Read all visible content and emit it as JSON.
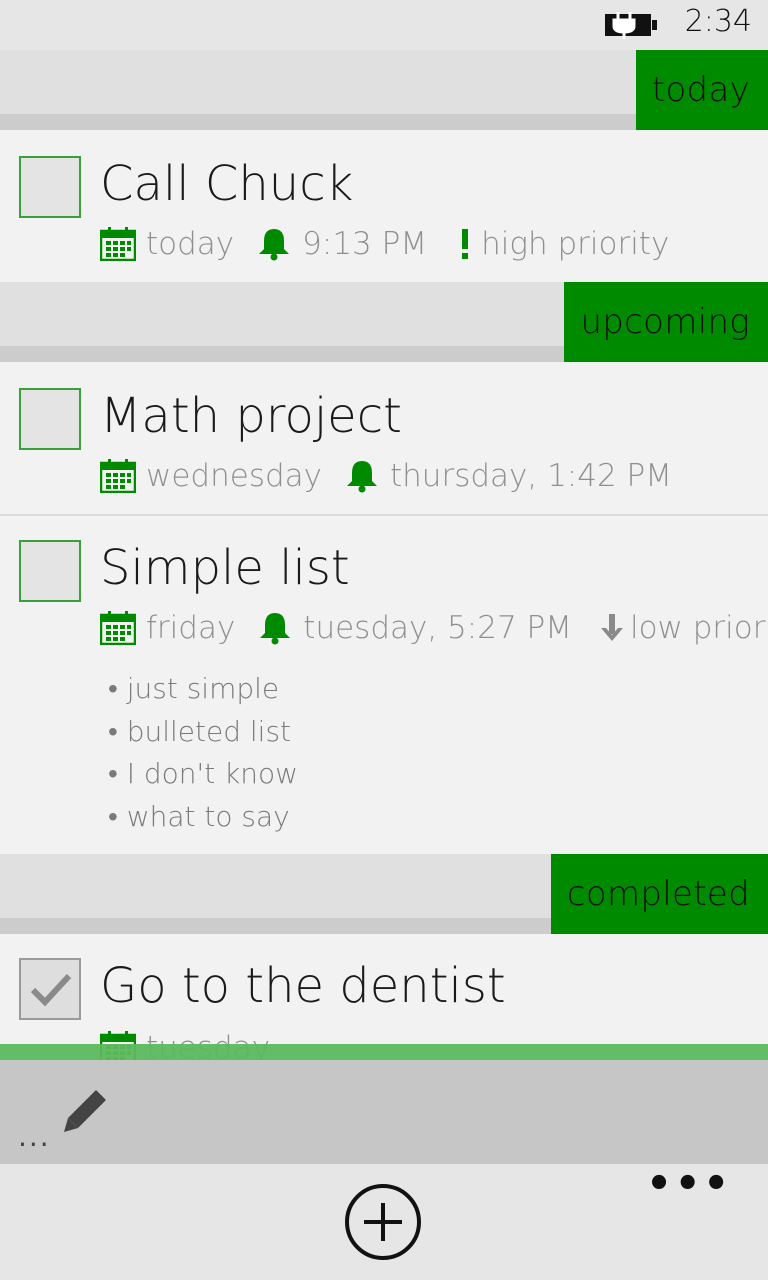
{
  "status": {
    "time": "2:34"
  },
  "groups": {
    "today": "today",
    "upcoming": "upcoming",
    "completed": "completed"
  },
  "tasks": [
    {
      "title": "Call Chuck",
      "due": "today",
      "reminder": "9:13 PM",
      "priority": "high priority",
      "completed": false
    },
    {
      "title": "Math project",
      "due": "wednesday",
      "reminder": "thursday, 1:42 PM",
      "completed": false
    },
    {
      "title": "Simple list",
      "due": "friday",
      "reminder": "tuesday, 5:27 PM",
      "priority": "low priority",
      "completed": false,
      "notes": [
        "• just simple",
        "• bulleted list",
        "• I don't know",
        "• what to say"
      ]
    },
    {
      "title": "Go to the dentist",
      "due": "tuesday",
      "completed": true
    }
  ],
  "edit_bar": {
    "dots": "..."
  },
  "app_bar": {
    "more": "•••"
  },
  "icons": {
    "calendar": "calendar-icon",
    "reminder": "bell-icon",
    "high_priority": "exclamation-icon",
    "low_priority": "down-arrow-icon",
    "battery": "battery-charging-icon",
    "edit": "pencil-icon",
    "add": "add-icon"
  },
  "colors": {
    "accent": "#008a00",
    "background": "#f2f2f2",
    "meta_text": "#8f8f8f"
  }
}
